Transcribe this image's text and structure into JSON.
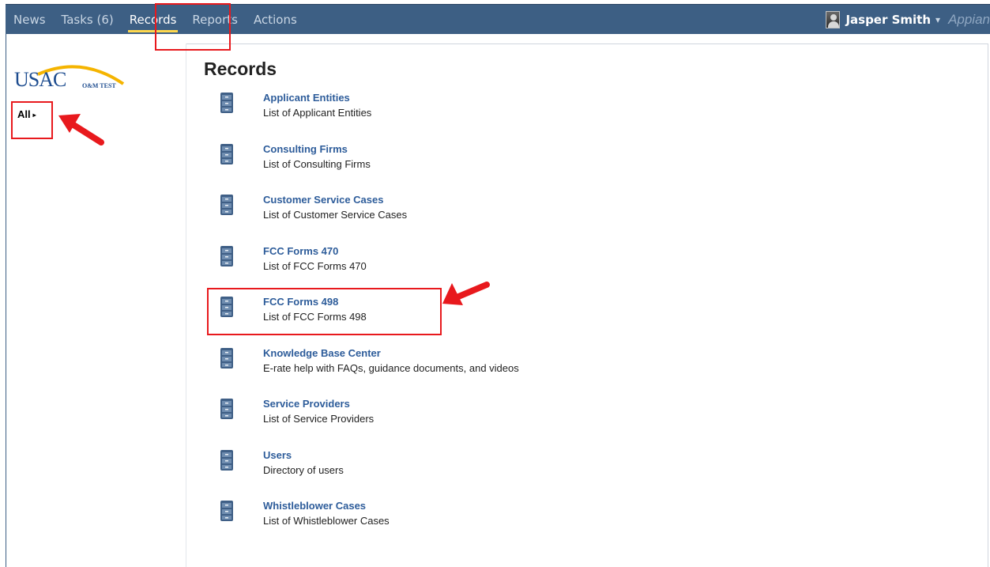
{
  "nav": {
    "tabs": [
      {
        "label": "News"
      },
      {
        "label": "Tasks (6)"
      },
      {
        "label": "Records"
      },
      {
        "label": "Reports"
      },
      {
        "label": "Actions"
      }
    ],
    "user_name": "Jasper Smith",
    "caret": "▾",
    "brand": "Appian"
  },
  "sidebar": {
    "logo_text": "USAC",
    "logo_sub": "O&M TEST",
    "all_label": "All",
    "all_arrow": "▸"
  },
  "main": {
    "title": "Records",
    "records": [
      {
        "name": "Applicant Entities",
        "desc": "List of Applicant Entities"
      },
      {
        "name": "Consulting Firms",
        "desc": "List of Consulting Firms"
      },
      {
        "name": "Customer Service Cases",
        "desc": "List of Customer Service Cases"
      },
      {
        "name": "FCC Forms 470",
        "desc": "List of FCC Forms 470"
      },
      {
        "name": "FCC Forms 498",
        "desc": "List of FCC Forms 498"
      },
      {
        "name": "Knowledge Base Center",
        "desc": "E-rate help with FAQs, guidance documents, and videos"
      },
      {
        "name": "Service Providers",
        "desc": "List of Service Providers"
      },
      {
        "name": "Users",
        "desc": "Directory of users"
      },
      {
        "name": "Whistleblower Cases",
        "desc": "List of Whistleblower Cases"
      }
    ]
  },
  "colors": {
    "nav_bg": "#3d5f84",
    "active_underline": "#ffd84d",
    "link": "#2d5c9a",
    "annotation_red": "#e8191d"
  }
}
